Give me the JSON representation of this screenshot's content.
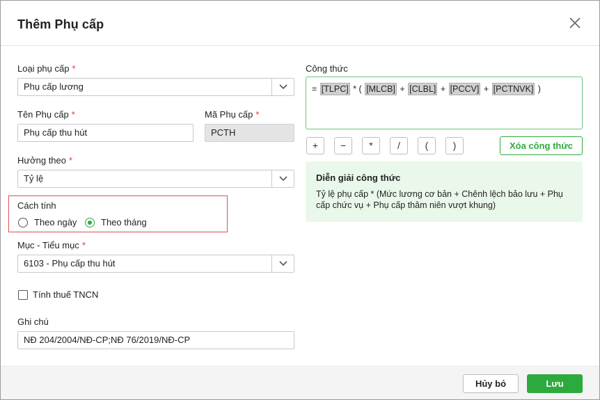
{
  "dialog": {
    "title": "Thêm Phụ cấp",
    "close_icon": "close-icon"
  },
  "form": {
    "allowance_type": {
      "label": "Loại phụ cấp",
      "required": "*",
      "value": "Phụ cấp lương"
    },
    "allowance_name": {
      "label": "Tên Phụ cấp",
      "required": "*",
      "value": "Phụ cấp thu hút"
    },
    "allowance_code": {
      "label": "Mã Phụ cấp",
      "required": "*",
      "value": "PCTH"
    },
    "based_on": {
      "label": "Hưởng theo",
      "required": "*",
      "value": "Tỷ lệ"
    },
    "calc_method": {
      "label": "Cách tính",
      "options": [
        {
          "label": "Theo ngày",
          "selected": false
        },
        {
          "label": "Theo tháng",
          "selected": true
        }
      ]
    },
    "item_subitem": {
      "label": "Mục - Tiểu mục",
      "required": "*",
      "value": "6103 - Phụ cấp thu hút"
    },
    "pit_checkbox": {
      "label": "Tính thuế TNCN",
      "checked": false
    },
    "note": {
      "label": "Ghi chú",
      "value": "NĐ 204/2004/NĐ-CP;NĐ 76/2019/NĐ-CP"
    }
  },
  "formula": {
    "label": "Công thức",
    "parts": [
      "=",
      "[TLPC]",
      "*",
      "(",
      "[MLCB]",
      "+",
      "[CLBL]",
      "+",
      "[PCCV]",
      "+",
      "[PCTNVK]",
      ")"
    ],
    "operators": [
      "+",
      "−",
      "*",
      "/",
      "(",
      ")"
    ],
    "clear_label": "Xóa công thức"
  },
  "explanation": {
    "heading": "Diễn giải công thức",
    "text": "Tỷ lệ phụ cấp * (Mức lương cơ bản + Chênh lệch bảo lưu + Phụ cấp chức vụ + Phụ cấp thâm niên vượt khung)"
  },
  "footer": {
    "cancel_label": "Hủy bỏ",
    "save_label": "Lưu"
  },
  "colors": {
    "accent": "#2daa3d",
    "required": "#e53935",
    "highlight_border": "#e04e4e",
    "explain_bg": "#e9f8ea"
  }
}
